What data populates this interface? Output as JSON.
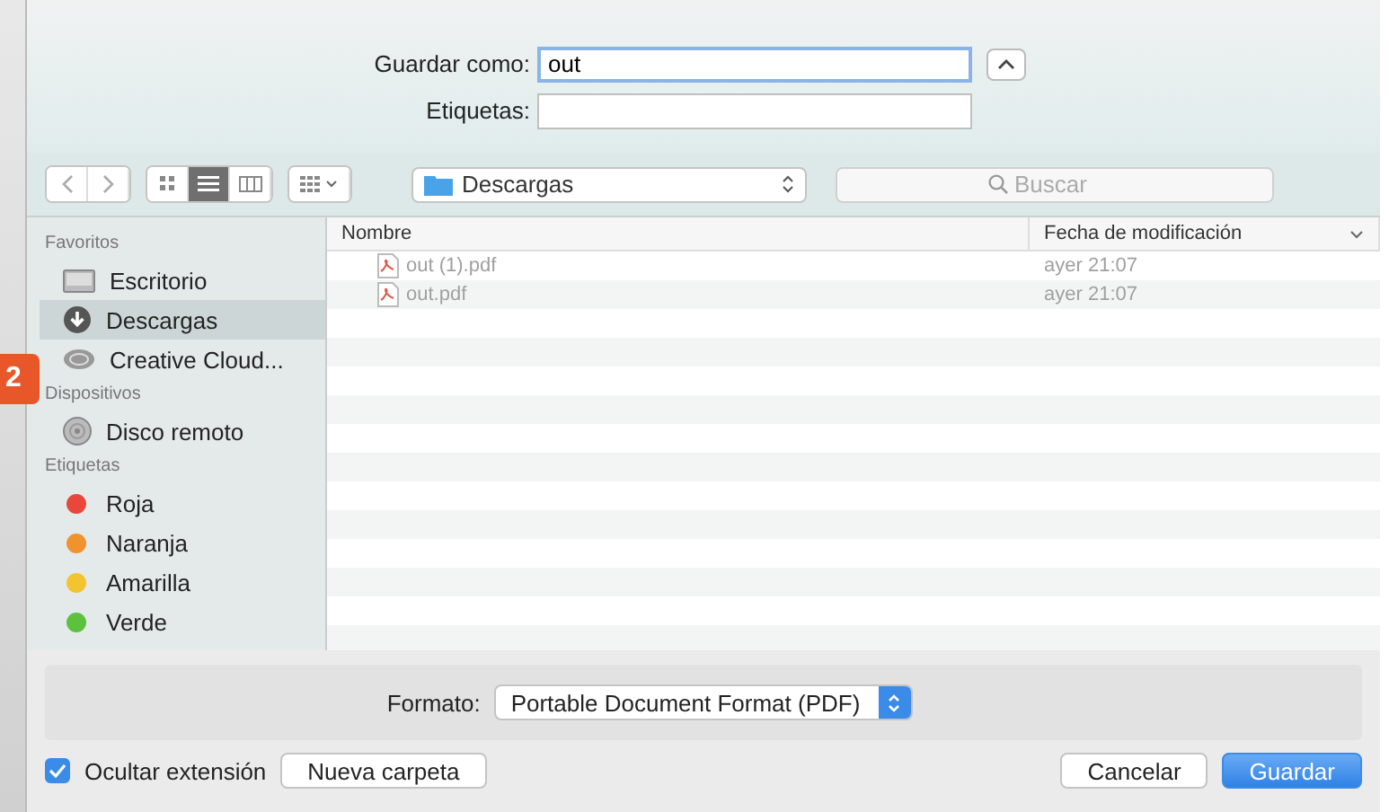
{
  "background_badge": "2",
  "save_as": {
    "label": "Guardar como:",
    "value": "out",
    "expanded": true
  },
  "tags_field": {
    "label": "Etiquetas:"
  },
  "toolbar": {
    "view_modes": [
      {
        "kind": "icons",
        "selected": false
      },
      {
        "kind": "list",
        "selected": true
      },
      {
        "kind": "columns",
        "selected": false
      }
    ],
    "location": "Descargas",
    "search": {
      "placeholder": "Buscar"
    }
  },
  "sidebar": {
    "sections": [
      {
        "title": "Favoritos",
        "items": [
          {
            "kind": "desktop",
            "label": "Escritorio",
            "selected": false
          },
          {
            "kind": "downloads",
            "label": "Descargas",
            "selected": true
          },
          {
            "kind": "cloud",
            "label": "Creative Cloud...",
            "selected": false
          }
        ]
      },
      {
        "title": "Dispositivos",
        "items": [
          {
            "kind": "disk",
            "label": "Disco remoto",
            "selected": false
          }
        ]
      },
      {
        "title": "Etiquetas",
        "items": [
          {
            "kind": "tag",
            "label": "Roja",
            "color": "#e8473c",
            "selected": false
          },
          {
            "kind": "tag",
            "label": "Naranja",
            "color": "#f0932f",
            "selected": false
          },
          {
            "kind": "tag",
            "label": "Amarilla",
            "color": "#f3c430",
            "selected": false
          },
          {
            "kind": "tag",
            "label": "Verde",
            "color": "#5cc23d",
            "selected": false
          }
        ]
      }
    ]
  },
  "table": {
    "columns": [
      "Nombre",
      "Fecha de modificación"
    ],
    "rows": [
      {
        "name": "out (1).pdf",
        "date": "ayer 21:07",
        "disabled": true
      },
      {
        "name": "out.pdf",
        "date": "ayer 21:07",
        "disabled": true
      }
    ]
  },
  "format": {
    "label": "Formato:",
    "value": "Portable Document Format (PDF)"
  },
  "hide_extension": {
    "label": "Ocultar extensión",
    "checked": true
  },
  "buttons": [
    {
      "kind": "secondary",
      "label": "Nueva carpeta"
    },
    {
      "kind": "secondary",
      "label": "Cancelar"
    },
    {
      "kind": "primary",
      "label": "Guardar"
    }
  ]
}
